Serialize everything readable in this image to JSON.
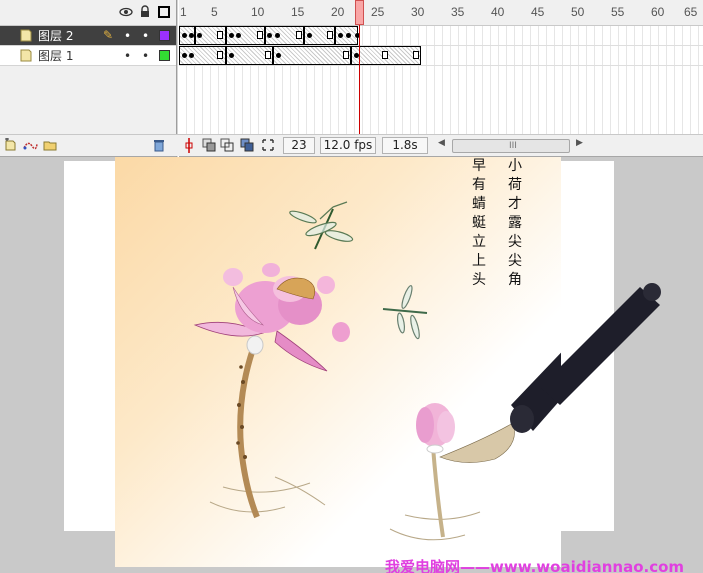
{
  "timeline": {
    "ruler_ticks": [
      "1",
      "5",
      "10",
      "15",
      "20",
      "25",
      "30",
      "35",
      "40",
      "45",
      "50",
      "55",
      "60",
      "65"
    ],
    "header_icons": [
      "eye-icon",
      "lock-icon",
      "outline-icon"
    ],
    "layers": [
      {
        "name": "图层 2",
        "selected": true,
        "color": "#9b30ff",
        "editable": true
      },
      {
        "name": "图层 1",
        "selected": false,
        "color": "#33dd33",
        "editable": false
      }
    ],
    "current_frame": "23",
    "fps": "12.0 fps",
    "elapsed": "1.8s",
    "scroll_grip": "III"
  },
  "stage": {
    "poem_lines": [
      "小荷才露尖尖角",
      "早有蜻蜓立上头"
    ],
    "watermark": "我爱电脑网——www.woaidiannao.com",
    "colors": {
      "background_warm": "#fbd9a6",
      "lotus": "#e889c9",
      "brush_handle": "#1e1e2a"
    }
  }
}
